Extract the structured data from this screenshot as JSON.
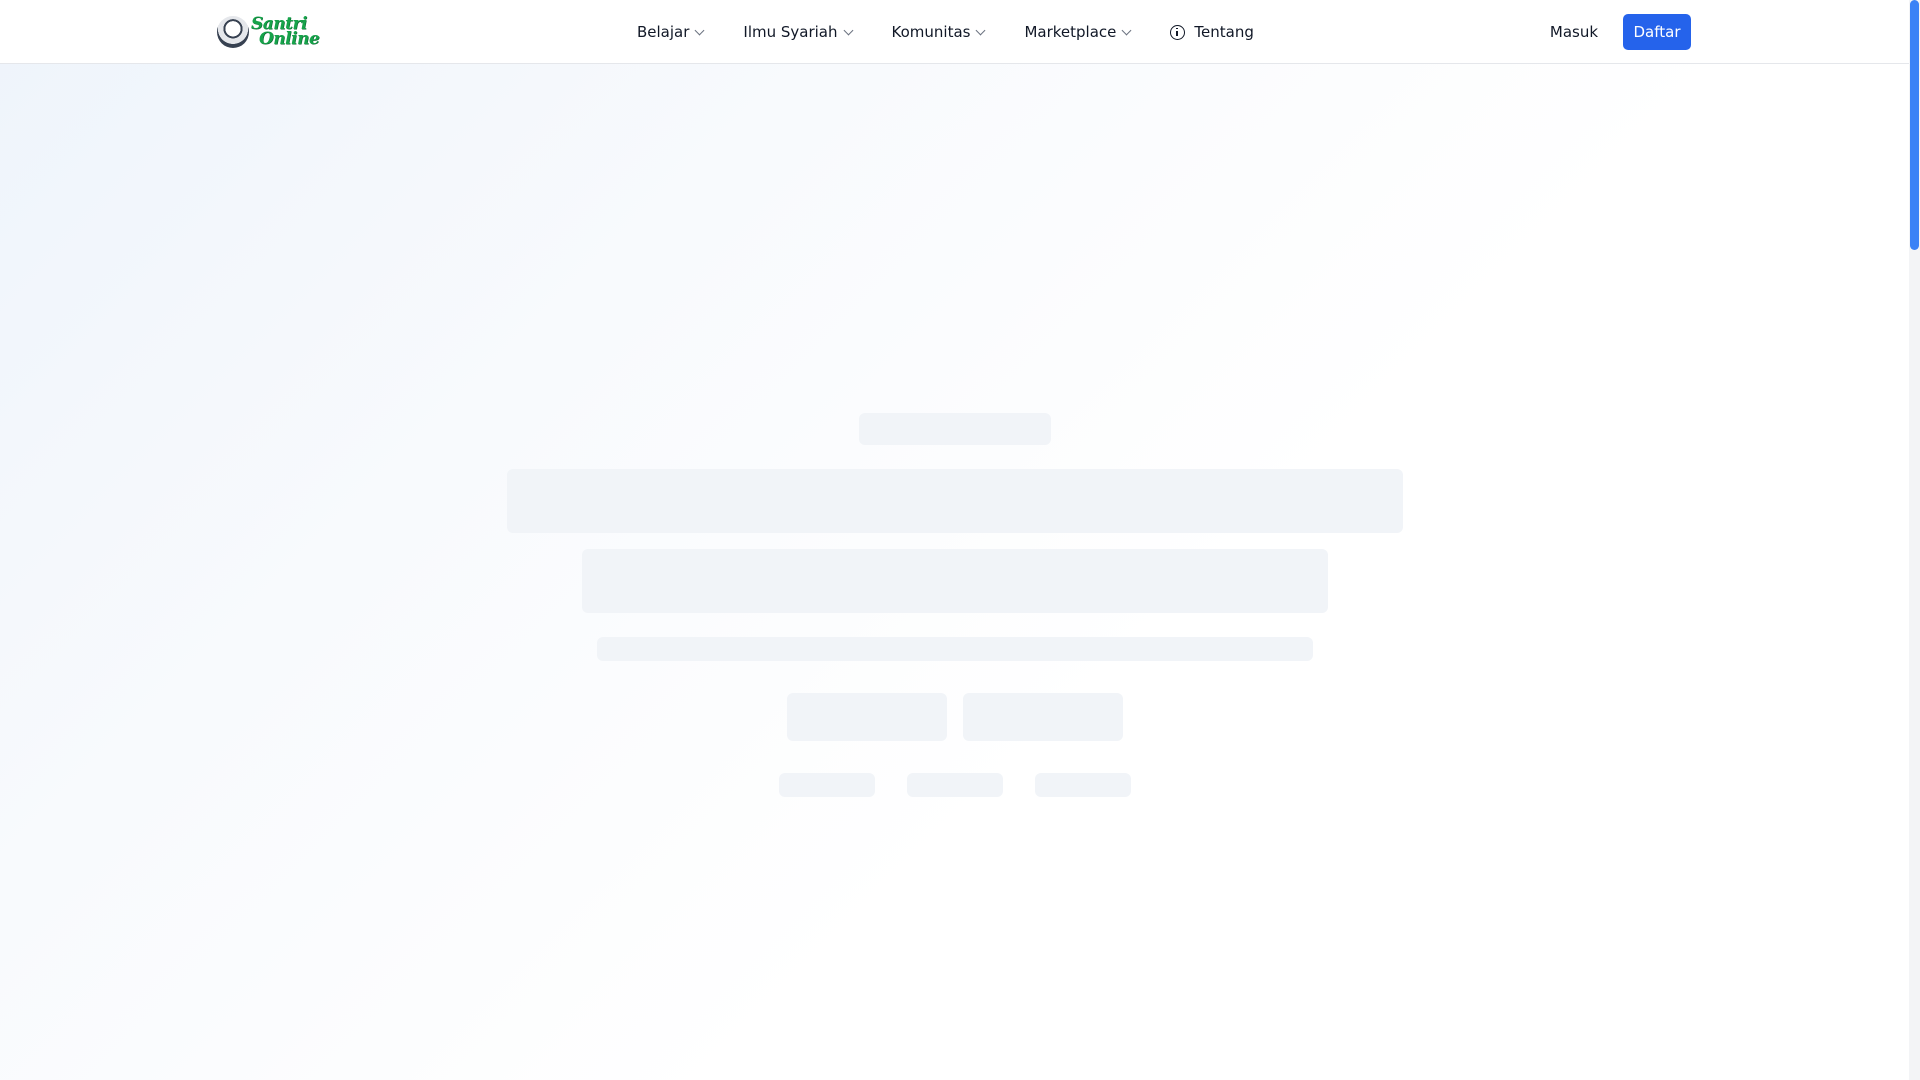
{
  "brand": {
    "logo_line1": "Santri",
    "logo_line2": "Online",
    "color": "#16a34a"
  },
  "nav": {
    "items": [
      {
        "label": "Belajar",
        "has_dropdown": true
      },
      {
        "label": "Ilmu Syariah",
        "has_dropdown": true
      },
      {
        "label": "Komunitas",
        "has_dropdown": true
      },
      {
        "label": "Marketplace",
        "has_dropdown": true
      },
      {
        "label": "Tentang",
        "icon": "info-icon"
      }
    ]
  },
  "auth": {
    "login_label": "Masuk",
    "register_label": "Daftar",
    "accent_color": "#2563eb"
  },
  "hero": {
    "state": "loading-skeleton"
  }
}
